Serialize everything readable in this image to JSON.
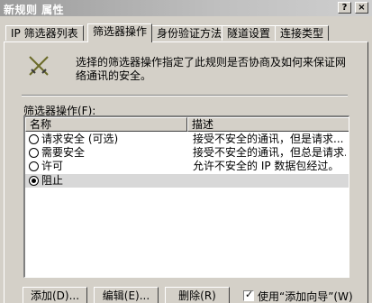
{
  "window": {
    "title": "新规则 属性",
    "help_button": "?",
    "close_button": "×"
  },
  "tabs": [
    {
      "label": "IP 筛选器列表"
    },
    {
      "label": "筛选器操作"
    },
    {
      "label": "身份验证方法"
    },
    {
      "label": "隧道设置"
    },
    {
      "label": "连接类型"
    }
  ],
  "active_tab_index": 1,
  "description": {
    "icon": "crossed-swords-icon",
    "text": "选择的筛选器操作指定了此规则是否协商及如何来保证网络通讯的安全。"
  },
  "list": {
    "label": "筛选器操作(F):",
    "columns": [
      {
        "label": "名称"
      },
      {
        "label": "描述"
      }
    ],
    "rows": [
      {
        "name": "请求安全 (可选)",
        "description": "接受不安全的通讯，但是请求...",
        "checked": false,
        "selected": false
      },
      {
        "name": "需要安全",
        "description": "接受不安全的通讯，但总是请求...",
        "checked": false,
        "selected": false
      },
      {
        "name": "许可",
        "description": "允许不安全的 IP 数据包经过。",
        "checked": false,
        "selected": false
      },
      {
        "name": "阻止",
        "description": "",
        "checked": true,
        "selected": true
      }
    ]
  },
  "buttons": {
    "add": "添加(D)...",
    "edit": "编辑(E)...",
    "remove": "删除(R)"
  },
  "wizard_checkbox": {
    "label": "使用“添加向导”(W)",
    "checked": true,
    "mark": "✓"
  }
}
